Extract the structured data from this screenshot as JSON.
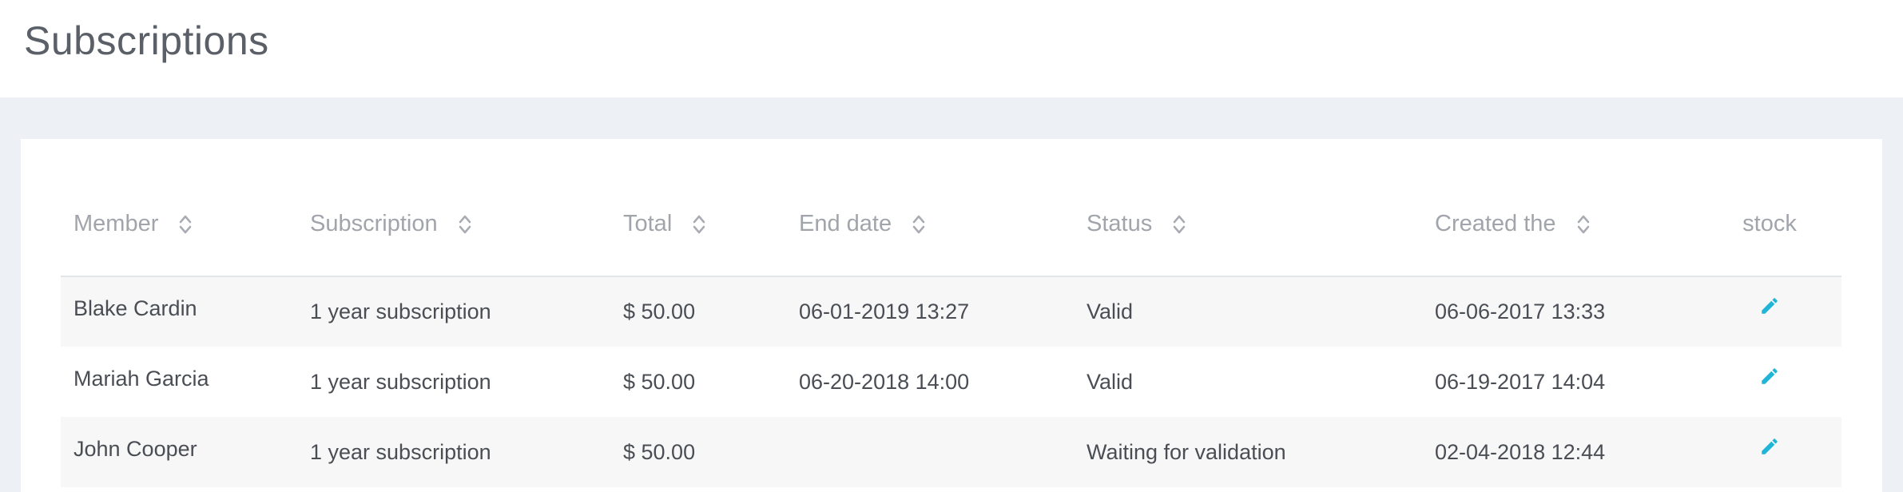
{
  "page": {
    "title": "Subscriptions"
  },
  "table": {
    "columns": [
      {
        "label": "Member",
        "sortable": true
      },
      {
        "label": "Subscription",
        "sortable": true
      },
      {
        "label": "Total",
        "sortable": true
      },
      {
        "label": "End date",
        "sortable": true
      },
      {
        "label": "Status",
        "sortable": true
      },
      {
        "label": "Created the",
        "sortable": true
      },
      {
        "label": "stock",
        "sortable": false
      }
    ],
    "rows": [
      {
        "member": "Blake Cardin",
        "subscription": "1 year subscription",
        "total": "$ 50.00",
        "end_date": "06-01-2019 13:27",
        "status": "Valid",
        "created": "06-06-2017 13:33",
        "action_icon": "pencil-icon"
      },
      {
        "member": "Mariah Garcia",
        "subscription": "1 year subscription",
        "total": "$ 50.00",
        "end_date": "06-20-2018 14:00",
        "status": "Valid",
        "created": "06-19-2017 14:04",
        "action_icon": "pencil-icon"
      },
      {
        "member": "John Cooper",
        "subscription": "1 year subscription",
        "total": "$ 50.00",
        "end_date": "",
        "status": "Waiting for validation",
        "created": "02-04-2018 12:44",
        "action_icon": "pencil-icon"
      }
    ]
  },
  "colors": {
    "accent": "#1fb5d6",
    "header_text": "#a1a5ab",
    "row_alt_bg": "#f7f7f7",
    "page_bg": "#edf1f5"
  }
}
